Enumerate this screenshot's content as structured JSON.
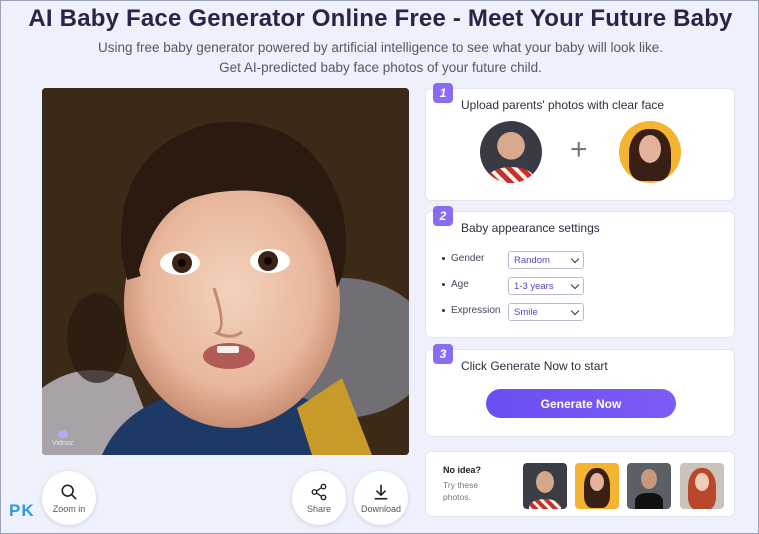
{
  "header": {
    "title": "AI Baby Face Generator Online Free - Meet Your Future Baby",
    "subtitle_line1": "Using free baby generator powered by artificial intelligence to see what your baby will look like.",
    "subtitle_line2": "Get AI-predicted baby face photos of your future child."
  },
  "preview": {
    "watermark": "Vidnoz",
    "actions": {
      "zoom_label": "Zoom in",
      "share_label": "Share",
      "download_label": "Download"
    }
  },
  "corner_logo": {
    "p": "P",
    "k": "K"
  },
  "steps": {
    "upload": {
      "number": "1",
      "title": "Upload parents' photos with clear face",
      "plus": "+"
    },
    "settings": {
      "number": "2",
      "title": "Baby appearance settings",
      "fields": [
        {
          "label": "Gender",
          "value": "Random"
        },
        {
          "label": "Age",
          "value": "1-3 years"
        },
        {
          "label": "Expression",
          "value": "Smile"
        }
      ]
    },
    "generate": {
      "number": "3",
      "title": "Click Generate Now to start",
      "button_label": "Generate Now"
    }
  },
  "ideas": {
    "heading": "No idea?",
    "hint": "Try these photos."
  },
  "colors": {
    "accent": "#7b5cf5",
    "title": "#2c2346",
    "background": "#eef0fb"
  }
}
